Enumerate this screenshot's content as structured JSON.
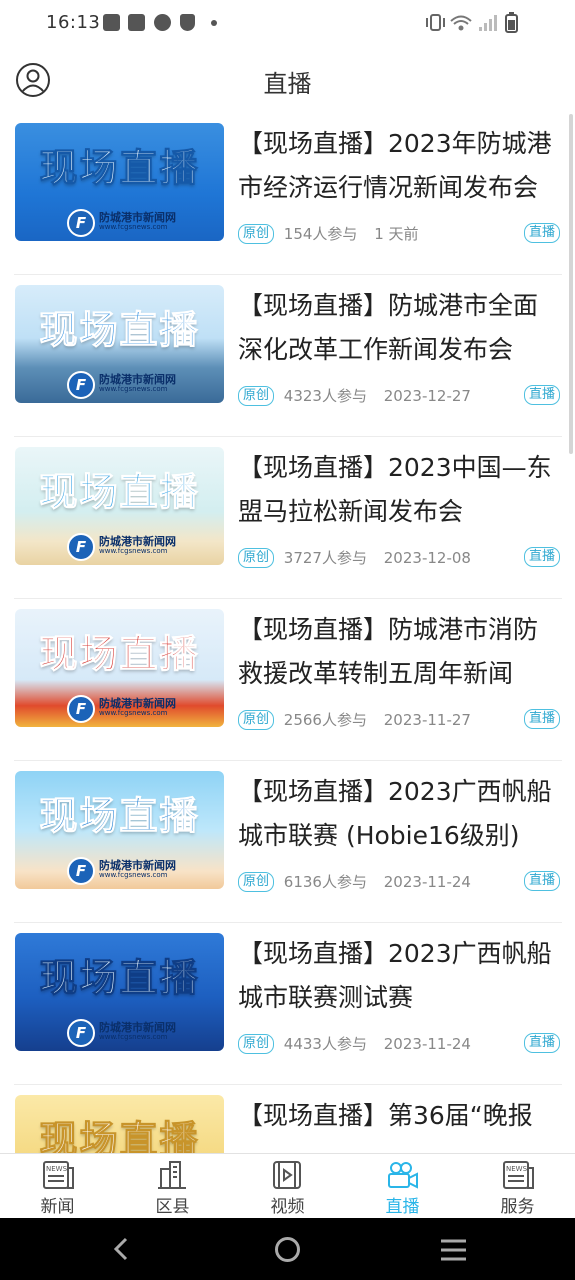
{
  "status_bar": {
    "time": "16:13",
    "icons": [
      "notification-icon",
      "notification-icon",
      "check-icon",
      "shield-icon",
      "dot-icon",
      "vibrate-icon",
      "wifi-icon",
      "signal-icon",
      "battery-icon"
    ]
  },
  "header": {
    "title": "直播",
    "avatar_icon": "user-avatar-icon"
  },
  "thumb_overlay": {
    "caption": "现场直播",
    "logo_mark": "F",
    "logo_name": "防城港市新闻网",
    "logo_url": "www.fcgsnews.com"
  },
  "items": [
    {
      "title": "【现场直播】2023年防城港市经济运行情况新闻发布会",
      "tag": "原创",
      "participants": "154人参与",
      "time": "1 天前",
      "live_tag": "直播",
      "thumb_style": "blue"
    },
    {
      "title": "【现场直播】防城港市全面深化改革工作新闻发布会",
      "tag": "原创",
      "participants": "4323人参与",
      "time": "2023-12-27",
      "live_tag": "直播",
      "thumb_style": "city"
    },
    {
      "title": "【现场直播】2023中国—东盟马拉松新闻发布会",
      "tag": "原创",
      "participants": "3727人参与",
      "time": "2023-12-08",
      "live_tag": "直播",
      "thumb_style": "marathon"
    },
    {
      "title": "【现场直播】防城港市消防救援改革转制五周年新闻发…",
      "tag": "原创",
      "participants": "2566人参与",
      "time": "2023-11-27",
      "live_tag": "直播",
      "thumb_style": "fire"
    },
    {
      "title": "【现场直播】2023广西帆船城市联赛 (Hobie16级别)",
      "tag": "原创",
      "participants": "6136人参与",
      "time": "2023-11-24",
      "live_tag": "直播",
      "thumb_style": "sky"
    },
    {
      "title": "【现场直播】2023广西帆船城市联赛测试赛",
      "tag": "原创",
      "participants": "4433人参与",
      "time": "2023-11-24",
      "live_tag": "直播",
      "thumb_style": "deepblue"
    },
    {
      "title": "【现场直播】第36届“晚报",
      "tag": "",
      "participants": "",
      "time": "",
      "live_tag": "",
      "thumb_style": "gold"
    }
  ],
  "tabbar": {
    "tabs": [
      {
        "label": "新闻",
        "icon": "news-icon",
        "active": false
      },
      {
        "label": "区县",
        "icon": "county-icon",
        "active": false
      },
      {
        "label": "视频",
        "icon": "video-icon",
        "active": false
      },
      {
        "label": "直播",
        "icon": "live-camera-icon",
        "active": true
      },
      {
        "label": "服务",
        "icon": "service-icon",
        "active": false
      }
    ]
  },
  "navbar": {
    "buttons": [
      "back-icon",
      "home-icon",
      "recents-icon"
    ]
  },
  "colors": {
    "accent": "#2ab5e8",
    "tag_border": "#4ec0e0",
    "meta_text": "#888888"
  }
}
